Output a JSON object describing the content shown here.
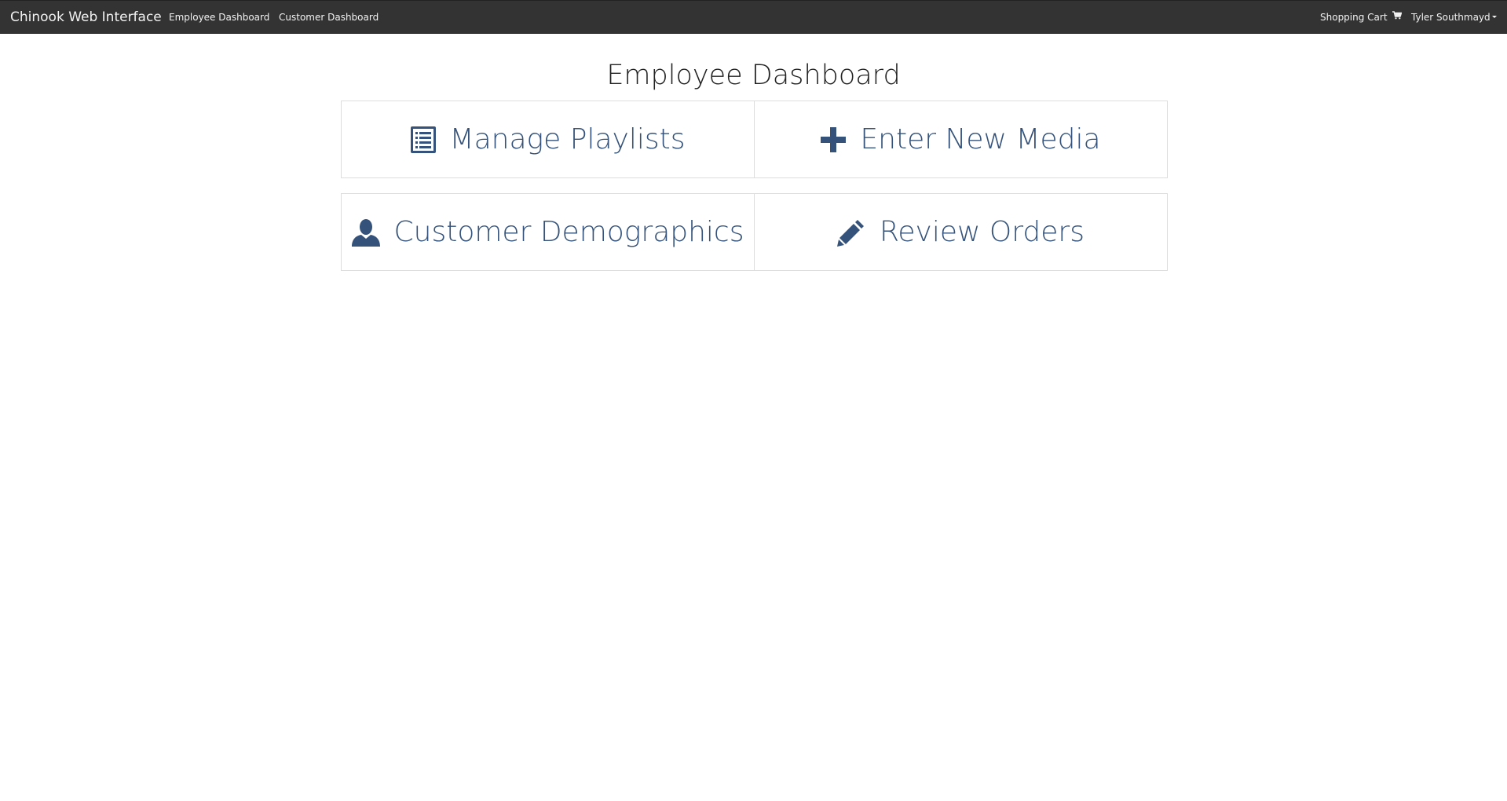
{
  "navbar": {
    "brand": "Chinook Web Interface",
    "links": [
      {
        "label": "Employee Dashboard"
      },
      {
        "label": "Customer Dashboard"
      }
    ],
    "right": {
      "cart_label": "Shopping Cart",
      "cart_icon": "shopping-cart-icon",
      "user_label": "Tyler Southmayd",
      "user_caret_icon": "caret-down-icon"
    }
  },
  "main": {
    "title": "Employee Dashboard",
    "tiles": [
      {
        "label": "Manage Playlists",
        "icon": "list-alt-icon"
      },
      {
        "label": "Enter New Media",
        "icon": "plus-icon"
      },
      {
        "label": "Customer Demographics",
        "icon": "user-icon"
      },
      {
        "label": "Review Orders",
        "icon": "pencil-icon"
      }
    ]
  },
  "colors": {
    "navbar_bg": "#333333",
    "navbar_text": "#f2f2f2",
    "tile_text": "#34527a",
    "tile_border": "#dddddd",
    "title_text": "#222222"
  }
}
